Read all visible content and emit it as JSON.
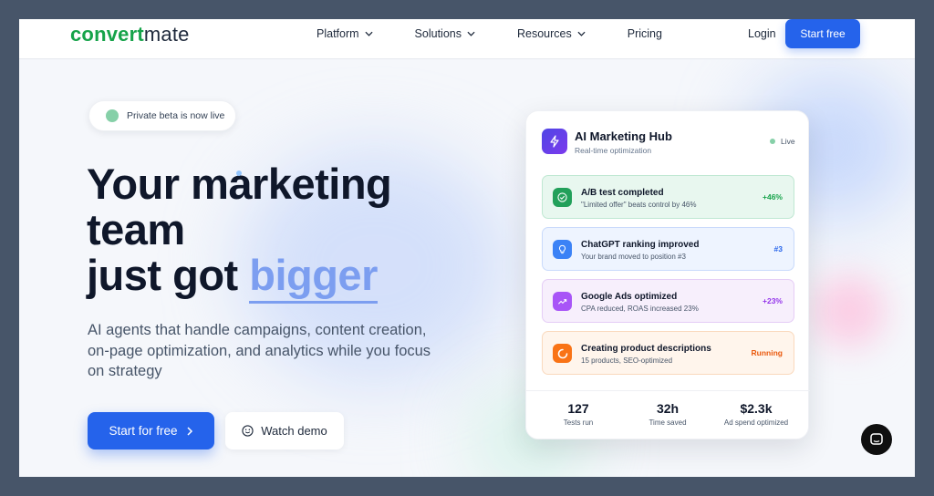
{
  "nav": {
    "logo_highlight": "convert",
    "logo_rest": "mate",
    "links": [
      {
        "label": "Platform"
      },
      {
        "label": "Solutions"
      },
      {
        "label": "Resources"
      },
      {
        "label": "Pricing"
      }
    ],
    "login_label": "Login",
    "cta_label": "Start free"
  },
  "hero": {
    "badge": "Private beta is now live",
    "headline_line1": "Your marketing",
    "headline_line2": "team",
    "headline_line3": "just got ",
    "headline_accent": "bigger",
    "subtext": "AI agents that handle campaigns, content creation, on-page optimization, and analytics while you focus on strategy",
    "primary_cta": "Start for free",
    "secondary_cta": "Watch demo"
  },
  "card": {
    "title": "AI Marketing Hub",
    "subtitle": "Real-time optimization",
    "status": "Live",
    "items": [
      {
        "title": "A/B test completed",
        "desc": "\"Limited offer\" beats control by 46%",
        "value": "+46%",
        "icon": "check-circle-icon"
      },
      {
        "title": "ChatGPT ranking improved",
        "desc": "Your brand moved to position #3",
        "value": "#3",
        "icon": "lightbulb-icon"
      },
      {
        "title": "Google Ads optimized",
        "desc": "CPA reduced, ROAS increased 23%",
        "value": "+23%",
        "icon": "trending-up-icon"
      },
      {
        "title": "Creating product descriptions",
        "desc": "15 products, SEO-optimized",
        "value": "Running",
        "icon": "spinner-icon"
      }
    ],
    "stats": [
      {
        "value": "127",
        "label": "Tests run"
      },
      {
        "value": "32h",
        "label": "Time saved"
      },
      {
        "value": "$2.3k",
        "label": "Ad spend optimized"
      }
    ]
  },
  "colors": {
    "primary": "#2563eb",
    "accent": "#7c9ef0",
    "logo_green": "#16a34a"
  }
}
